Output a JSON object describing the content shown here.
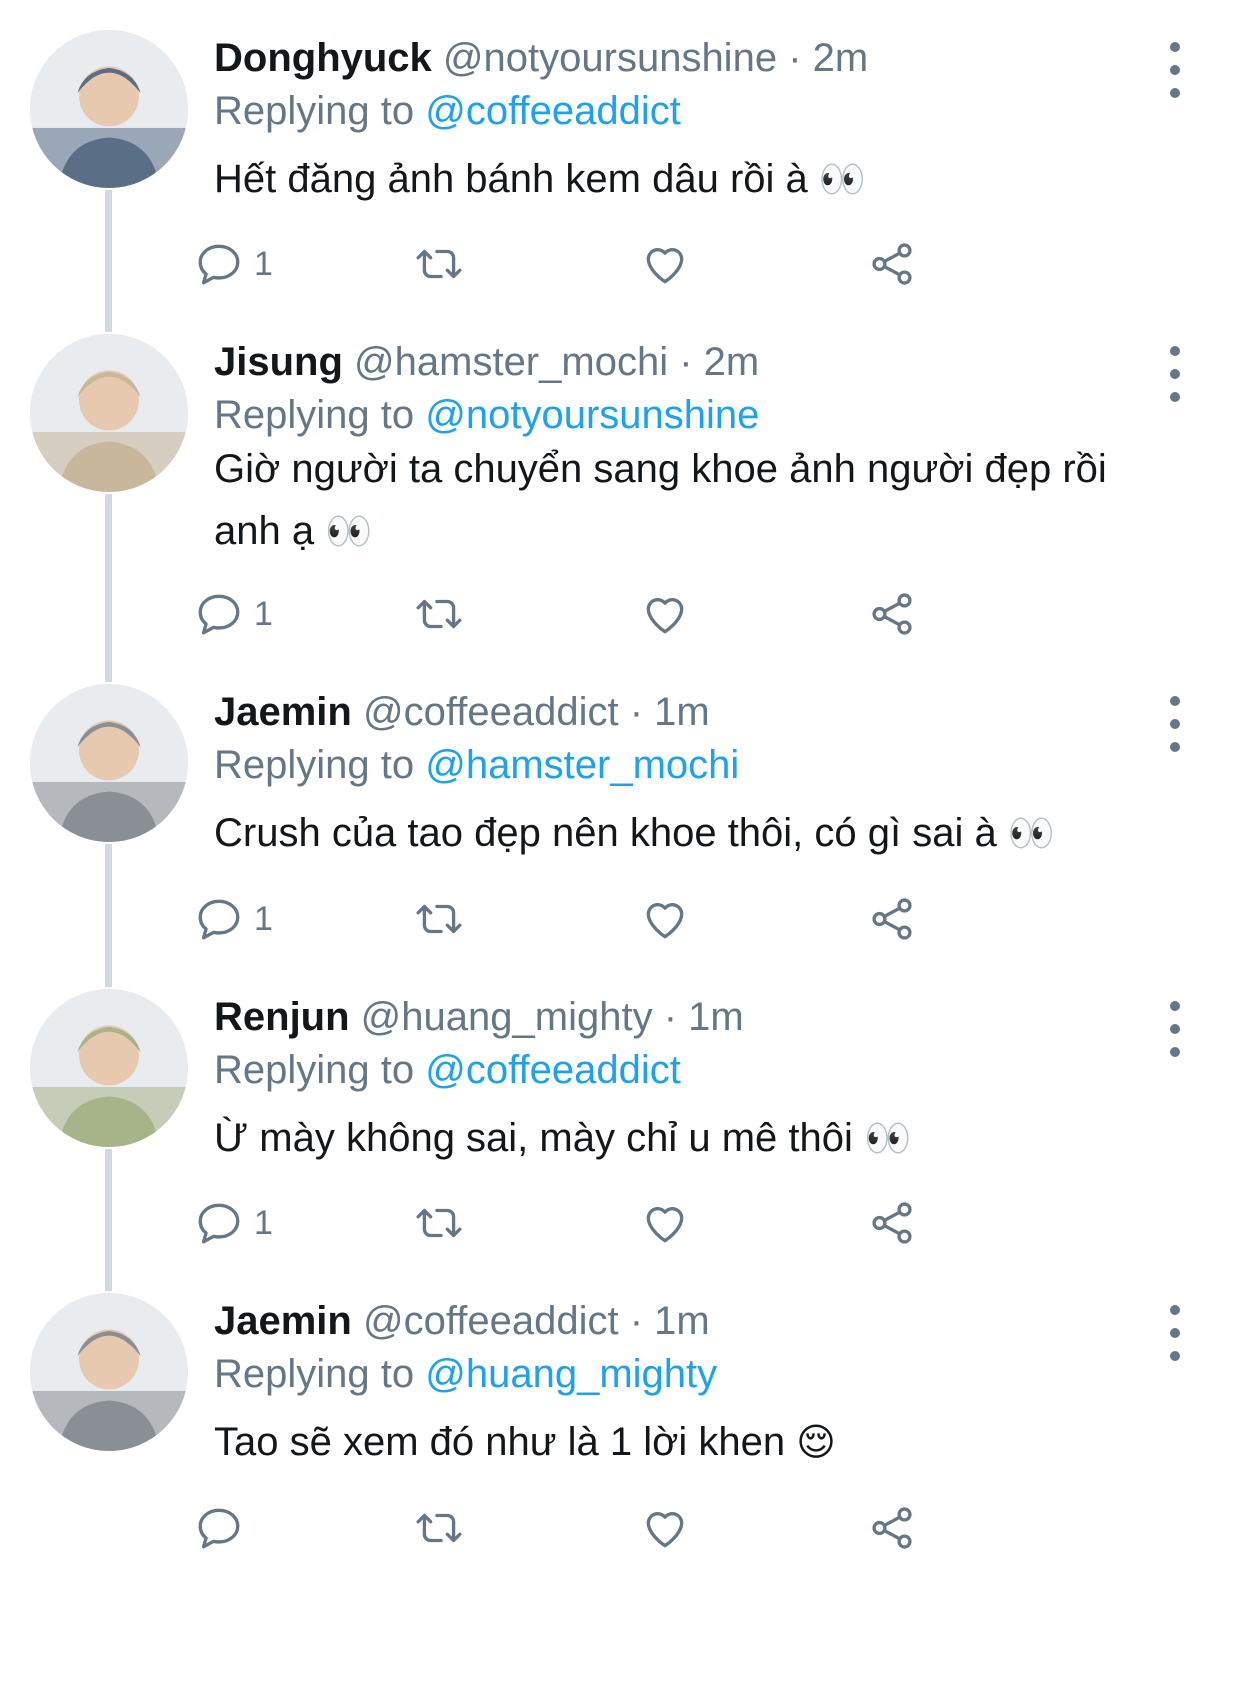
{
  "colors": {
    "link": "#1da1f2",
    "secondary_text": "#657786",
    "primary_text": "#14171a",
    "thread_line": "#cfd9de"
  },
  "icons": {
    "reply": "reply-icon",
    "retweet": "retweet-icon",
    "like": "heart-icon",
    "share": "share-icon",
    "more": "more-vertical-icon"
  },
  "tweets": [
    {
      "name": "Donghyuck",
      "handle": "@notyoursunshine",
      "time": "· 2m",
      "replying_prefix": "Replying to",
      "replying_to": "@coffeeaddict",
      "text": "Hết đăng ảnh bánh kem dâu rồi à",
      "emoji": "👀",
      "reply_count": "1"
    },
    {
      "name": "Jisung",
      "handle": "@hamster_mochi",
      "time": "· 2m",
      "replying_prefix": "Replying to",
      "replying_to": "@notyoursunshine",
      "text": "Giờ người ta chuyển sang khoe ảnh người đẹp rồi anh ạ",
      "emoji": "👀",
      "reply_count": "1"
    },
    {
      "name": "Jaemin",
      "handle": "@coffeeaddict",
      "time": "· 1m",
      "replying_prefix": "Replying to",
      "replying_to": "@hamster_mochi",
      "text": "Crush của tao đẹp nên khoe thôi, có gì sai à",
      "emoji": "👀",
      "reply_count": "1"
    },
    {
      "name": "Renjun",
      "handle": "@huang_mighty",
      "time": "· 1m",
      "replying_prefix": "Replying to",
      "replying_to": "@coffeeaddict",
      "text": "Ừ mày không sai, mày chỉ u mê thôi",
      "emoji": "👀",
      "reply_count": "1"
    },
    {
      "name": "Jaemin",
      "handle": "@coffeeaddict",
      "time": "· 1m",
      "replying_prefix": "Replying to",
      "replying_to": "@huang_mighty",
      "text": "Tao sẽ xem đó như là 1 lời khen",
      "emoji": "😌",
      "reply_count": ""
    }
  ]
}
